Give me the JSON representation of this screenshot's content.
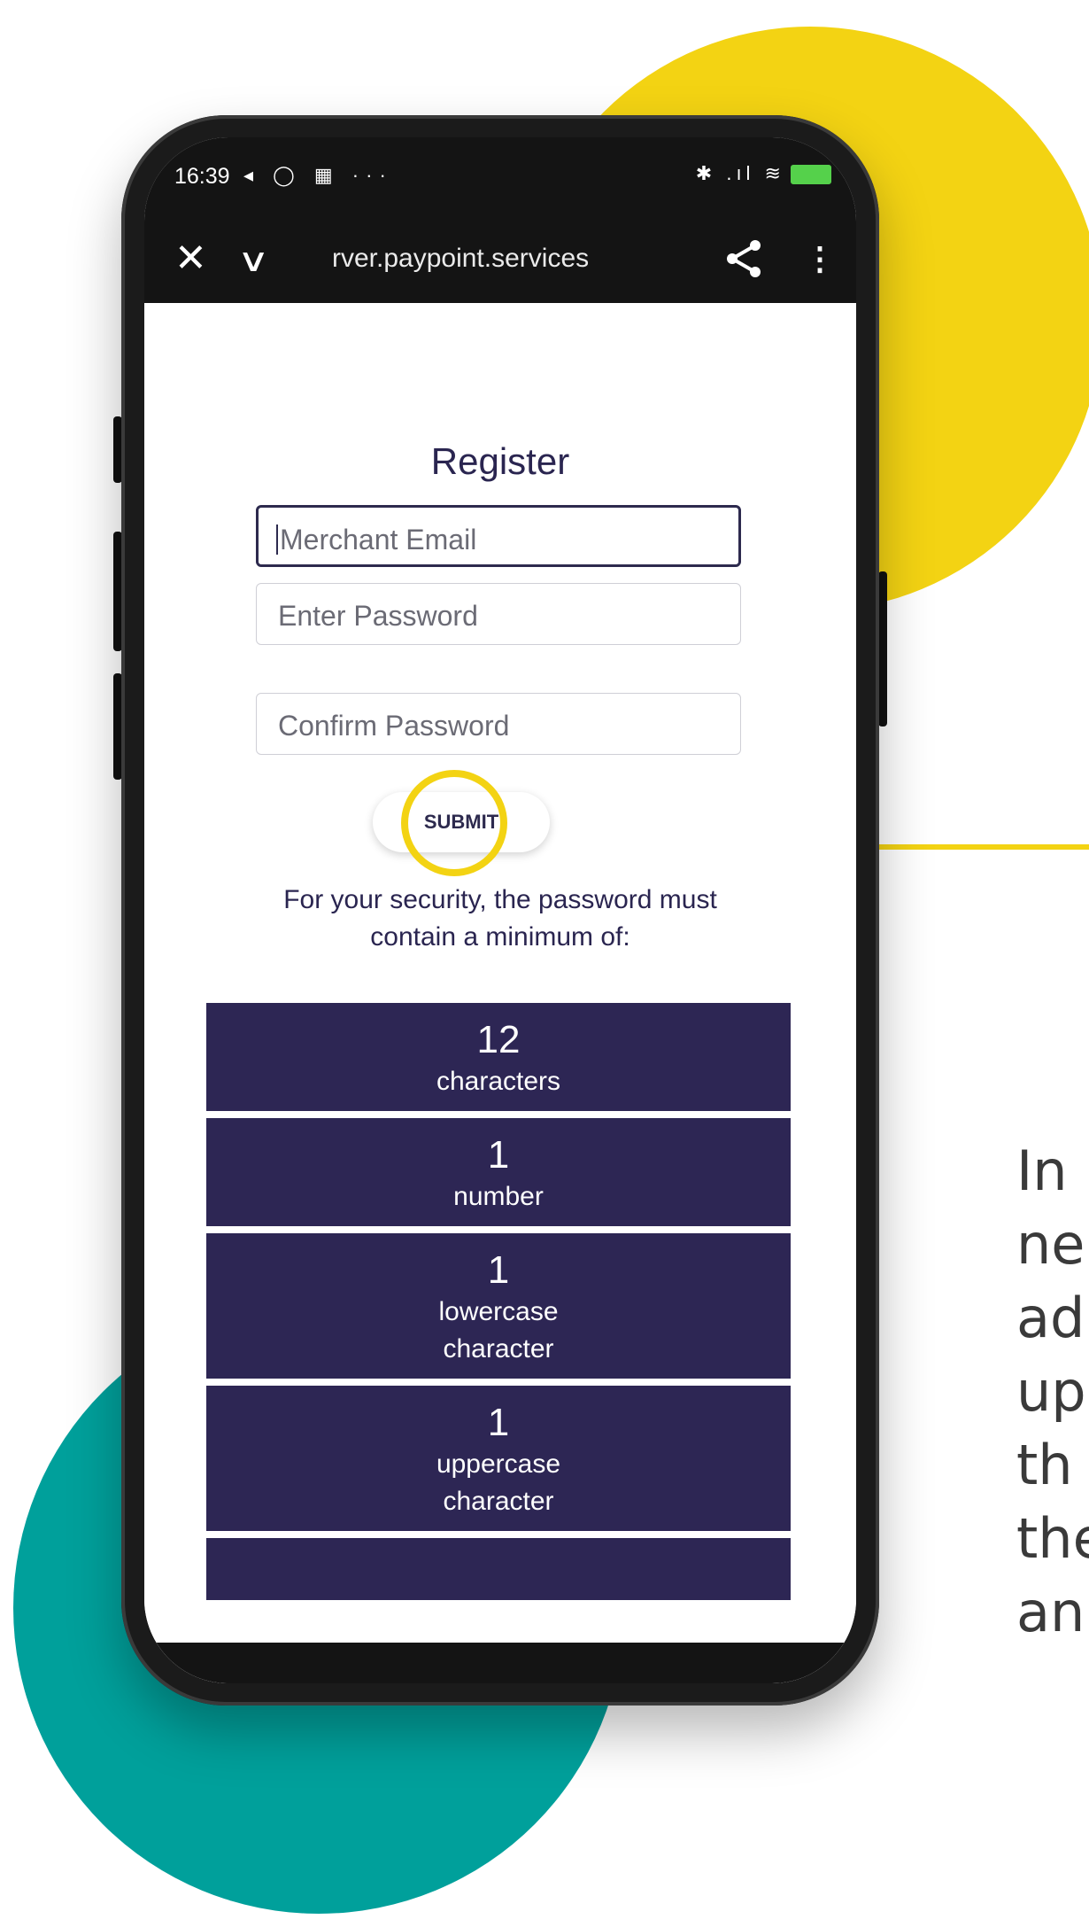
{
  "status_bar": {
    "time": "16:39",
    "left_icons": "◂ ◯ ▦ ···",
    "right_icons": "✱ .ıl ≋"
  },
  "browser": {
    "url": "rver.paypoint.services",
    "close_glyph": "✕",
    "chevron_glyph": "∨",
    "more_glyph": "⋮"
  },
  "form": {
    "title": "Register",
    "email_placeholder": "Merchant Email",
    "password_placeholder": "Enter Password",
    "confirm_placeholder": "Confirm Password",
    "submit_label": "SUBMIT"
  },
  "security_text": "For your security, the password must\ncontain a minimum of:",
  "rules": [
    {
      "count": "12",
      "label": "characters"
    },
    {
      "count": "1",
      "label": "number"
    },
    {
      "count": "1",
      "label": "lowercase\ncharacter"
    },
    {
      "count": "1",
      "label": "uppercase\ncharacter"
    }
  ],
  "side_text": [
    "In",
    "ne",
    "ad",
    "up",
    "th",
    "the",
    "an"
  ],
  "colors": {
    "yellow": "#f3d313",
    "teal": "#00a09b",
    "navy": "#2d2654"
  }
}
